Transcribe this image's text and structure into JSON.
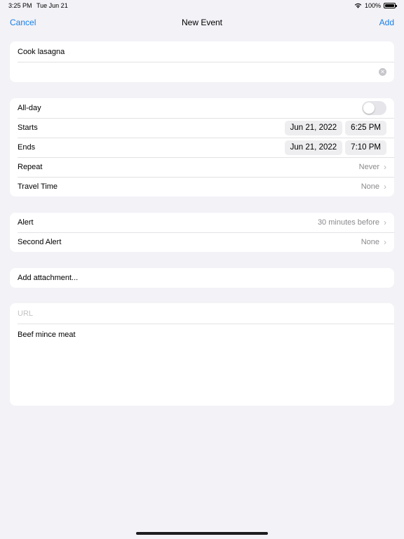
{
  "status_bar": {
    "time": "3:25 PM",
    "date": "Tue Jun 21",
    "battery": "100%",
    "battery_level": 1.0
  },
  "nav": {
    "cancel_label": "Cancel",
    "title": "New Event",
    "add_label": "Add"
  },
  "title_group": {
    "title_value": "Cook lasagna",
    "location_value": ""
  },
  "times_group": {
    "all_day_label": "All-day",
    "all_day_on": false,
    "starts_label": "Starts",
    "starts_date": "Jun 21, 2022",
    "starts_time": "6:25 PM",
    "ends_label": "Ends",
    "ends_date": "Jun 21, 2022",
    "ends_time": "7:10 PM",
    "repeat_label": "Repeat",
    "repeat_value": "Never",
    "travel_label": "Travel Time",
    "travel_value": "None"
  },
  "alerts_group": {
    "alert_label": "Alert",
    "alert_value": "30 minutes before",
    "second_alert_label": "Second Alert",
    "second_alert_value": "None"
  },
  "attach_group": {
    "attach_label": "Add attachment..."
  },
  "notes_group": {
    "url_placeholder": "URL",
    "notes_value": "Beef mince meat"
  },
  "colors": {
    "accent": "#1a7fe3",
    "background": "#f2f2f7",
    "secondary_text": "#8a8a8e"
  }
}
